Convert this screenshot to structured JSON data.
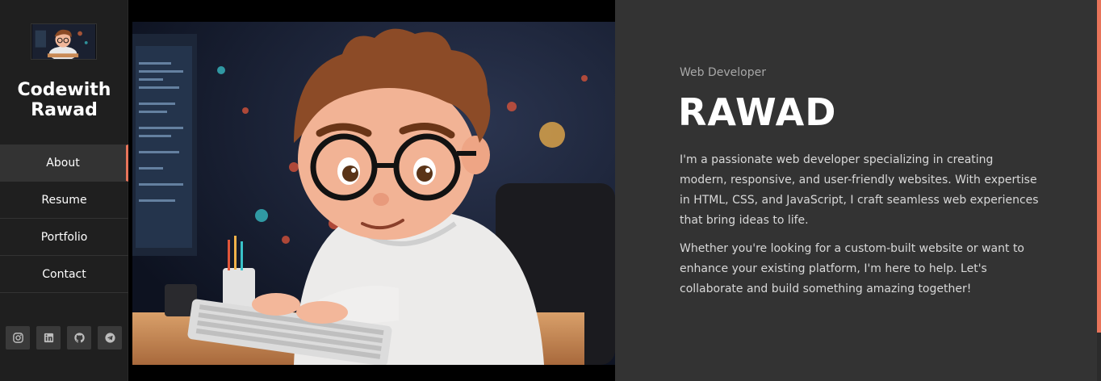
{
  "sidebar": {
    "brand_title": "Codewith Rawad",
    "nav": [
      {
        "label": "About",
        "active": true
      },
      {
        "label": "Resume",
        "active": false
      },
      {
        "label": "Portfolio",
        "active": false
      },
      {
        "label": "Contact",
        "active": false
      }
    ],
    "socials": [
      "instagram-icon",
      "linkedin-icon",
      "github-icon",
      "telegram-icon"
    ]
  },
  "hero": {
    "subtitle": "Web Developer",
    "name": "RAWAD",
    "paragraph1": "I'm a passionate web developer specializing in creating modern, responsive, and user-friendly websites. With expertise in HTML, CSS, and JavaScript, I craft seamless web experiences that bring ideas to life.",
    "paragraph2": "Whether you're looking for a custom-built website or want to enhance your existing platform, I'm here to help. Let's collaborate and build something amazing together!"
  },
  "colors": {
    "accent": "#e8745a",
    "sidebar_bg": "#1f1f1f",
    "content_bg": "#333333"
  }
}
